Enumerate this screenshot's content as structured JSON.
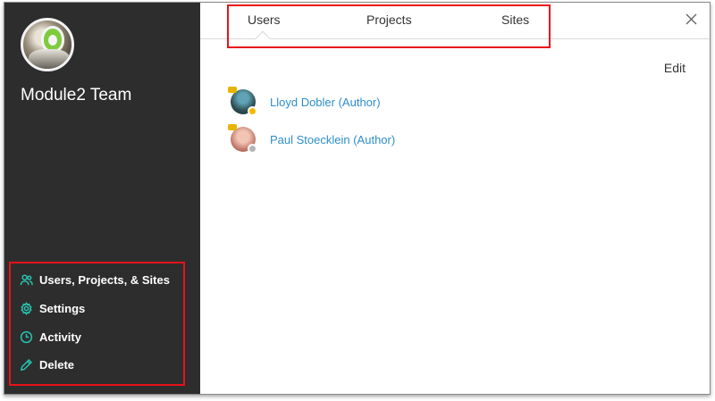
{
  "team": {
    "name": "Module2 Team"
  },
  "sidebar": {
    "items": [
      {
        "label": "Users, Projects, & Sites",
        "icon": "users-icon"
      },
      {
        "label": "Settings",
        "icon": "gear-icon"
      },
      {
        "label": "Activity",
        "icon": "clock-icon"
      },
      {
        "label": "Delete",
        "icon": "pencil-icon"
      }
    ]
  },
  "tabs": [
    "Users",
    "Projects",
    "Sites"
  ],
  "main": {
    "edit_label": "Edit",
    "users": [
      {
        "name": "Lloyd Dobler (Author)",
        "status_color": "#f5b800"
      },
      {
        "name": "Paul Stoecklein (Author)",
        "status_color": "#b5b5b5"
      }
    ]
  },
  "colors": {
    "accent": "#27c3b0",
    "link": "#2e8ecb",
    "sidebar_bg": "#2d2d2d",
    "highlight": "#e8121b"
  }
}
